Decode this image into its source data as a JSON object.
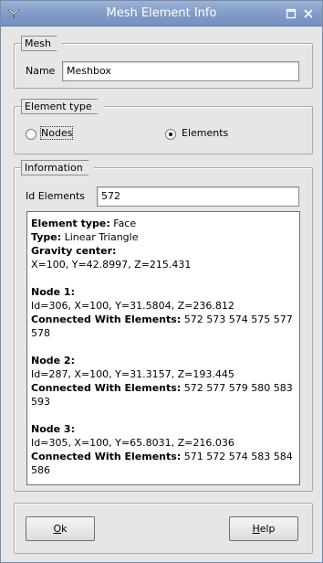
{
  "window": {
    "title": "Mesh Element Info"
  },
  "mesh": {
    "group_label": "Mesh",
    "name_label": "Name",
    "name_value": "Meshbox"
  },
  "element_type": {
    "group_label": "Element type",
    "options": [
      {
        "label": "Nodes",
        "checked": false
      },
      {
        "label": "Elements",
        "checked": true
      }
    ]
  },
  "information": {
    "group_label": "Information",
    "id_label": "Id Elements",
    "id_value": "572",
    "details": {
      "element_type_label": "Element type:",
      "element_type_value": " Face",
      "type_label": "Type:",
      "type_value": " Linear Triangle",
      "gravity_label": "Gravity center:",
      "gravity_value": "X=100, Y=42.8997, Z=215.431",
      "nodes": [
        {
          "title": "Node 1:",
          "coords": "Id=306, X=100, Y=31.5804, Z=236.812",
          "connected_label": "Connected With Elements:",
          "connected_value": " 572 573 574 575 577 578"
        },
        {
          "title": "Node 2:",
          "coords": "Id=287, X=100, Y=31.3157, Z=193.445",
          "connected_label": "Connected With Elements:",
          "connected_value": " 572 577 579 580 583 593"
        },
        {
          "title": "Node 3:",
          "coords": "Id=305, X=100, Y=65.8031, Z=216.036",
          "connected_label": "Connected With Elements:",
          "connected_value": " 571 572 574 583 584 586"
        }
      ]
    }
  },
  "buttons": {
    "ok_mnemonic": "O",
    "ok_rest": "k",
    "help_mnemonic": "H",
    "help_rest": "elp"
  }
}
